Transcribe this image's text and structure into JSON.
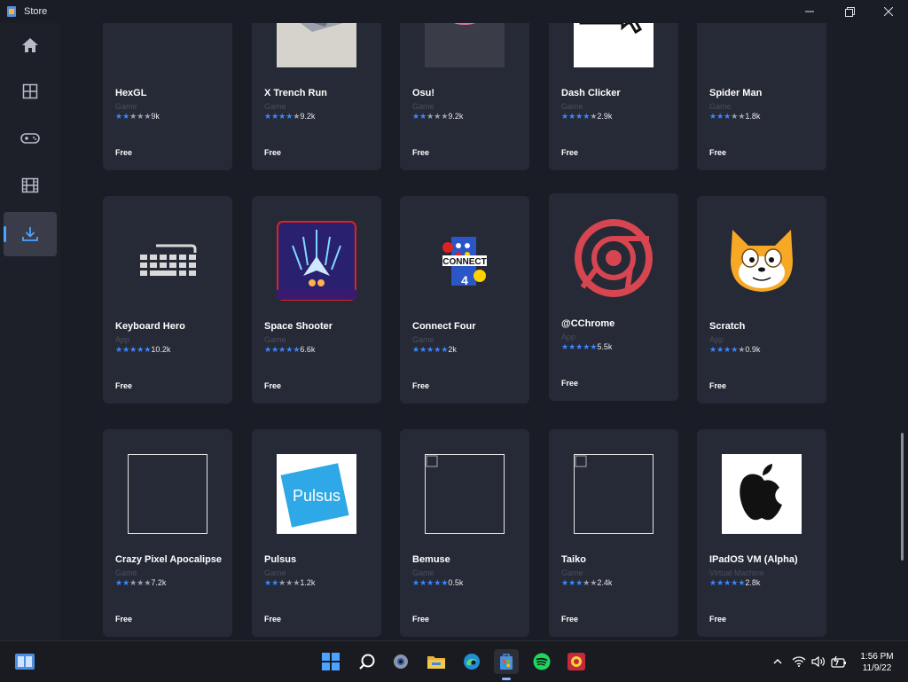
{
  "window": {
    "title": "Store"
  },
  "sidebar": {
    "items": [
      {
        "id": "home",
        "icon": "home-icon"
      },
      {
        "id": "apps",
        "icon": "apps-grid-icon"
      },
      {
        "id": "games",
        "icon": "gamepad-icon"
      },
      {
        "id": "movies",
        "icon": "film-icon"
      },
      {
        "id": "downloads",
        "icon": "download-icon",
        "active": true
      }
    ]
  },
  "apps": [
    {
      "name": "HexGL",
      "category": "Game",
      "stars": 2,
      "count": "9k",
      "price": "Free"
    },
    {
      "name": "X Trench Run",
      "category": "Game",
      "stars": 4,
      "count": "9.2k",
      "price": "Free"
    },
    {
      "name": "Osu!",
      "category": "Game",
      "stars": 2,
      "count": "9.2k",
      "price": "Free"
    },
    {
      "name": "Dash Clicker",
      "category": "Game",
      "stars": 4,
      "count": "2.9k",
      "price": "Free"
    },
    {
      "name": "Spider Man",
      "category": "Game",
      "stars": 3,
      "count": "1.8k",
      "price": "Free"
    },
    {
      "name": "Keyboard Hero",
      "category": "App",
      "stars": 5,
      "count": "10.2k",
      "price": "Free"
    },
    {
      "name": "Space Shooter",
      "category": "Game",
      "stars": 5,
      "count": "6.6k",
      "price": "Free"
    },
    {
      "name": "Connect Four",
      "category": "Game",
      "stars": 5,
      "count": "2k",
      "price": "Free"
    },
    {
      "name": "@CChrome",
      "category": "App",
      "stars": 5,
      "count": "5.5k",
      "price": "Free"
    },
    {
      "name": "Scratch",
      "category": "App",
      "stars": 4,
      "count": "0.9k",
      "price": "Free"
    },
    {
      "name": "Crazy Pixel Apocalipse",
      "category": "Game",
      "stars": 2,
      "count": "7.2k",
      "price": "Free"
    },
    {
      "name": "Pulsus",
      "category": "Game",
      "stars": 2,
      "count": "1.2k",
      "price": "Free"
    },
    {
      "name": "Bemuse",
      "category": "Game",
      "stars": 5,
      "count": "0.5k",
      "price": "Free"
    },
    {
      "name": "Taiko",
      "category": "Game",
      "stars": 3,
      "count": "2.4k",
      "price": "Free"
    },
    {
      "name": "IPadOS VM (Alpha)",
      "category": "Virtual Machine",
      "stars": 5,
      "count": "2.8k",
      "price": "Free"
    }
  ],
  "taskbar": {
    "pinned": [
      "start-icon",
      "search-icon",
      "settings-icon",
      "file-explorer-icon",
      "edge-icon",
      "store-icon",
      "spotify-icon",
      "game-icon"
    ],
    "time": "1:56 PM",
    "date": "11/9/22"
  },
  "colors": {
    "accent": "#3a86ff",
    "card": "#262a36",
    "background": "#1b1d26"
  }
}
